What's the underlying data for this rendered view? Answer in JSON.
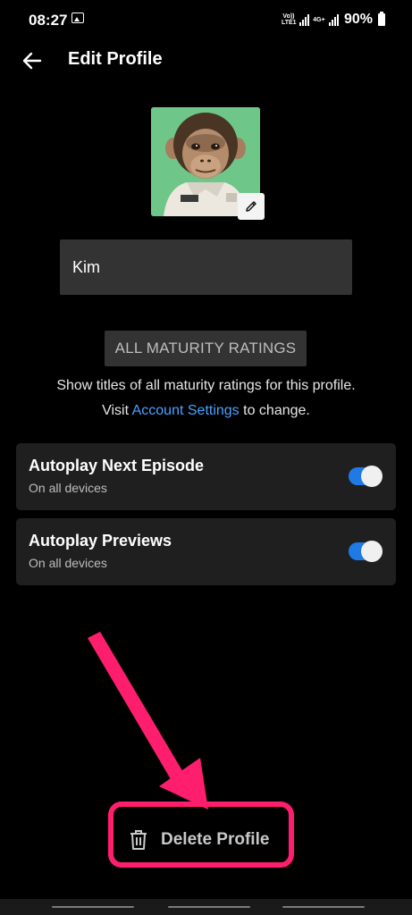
{
  "status_bar": {
    "time": "08:27",
    "net1_label": "Vo)) LTE1",
    "net2_label": "4G+",
    "battery": "90%"
  },
  "header": {
    "title": "Edit Profile"
  },
  "profile": {
    "name": "Kim"
  },
  "maturity": {
    "button_label": "ALL MATURITY RATINGS",
    "description": "Show titles of all maturity ratings for this profile.",
    "visit_prefix": "Visit",
    "link_text": "Account Settings",
    "visit_suffix": "to change."
  },
  "settings": [
    {
      "title": "Autoplay Next Episode",
      "subtitle": "On all devices",
      "enabled": true
    },
    {
      "title": "Autoplay Previews",
      "subtitle": "On all devices",
      "enabled": true
    }
  ],
  "delete": {
    "label": "Delete Profile"
  },
  "colors": {
    "toggle_on": "#1f7ae6",
    "link": "#4aa3ff",
    "annotation": "#ff1e6e",
    "avatar_bg": "#6fc689"
  },
  "icons": [
    "image-icon",
    "signal-icon",
    "battery-icon",
    "back-arrow-icon",
    "pencil-icon",
    "trash-icon"
  ]
}
